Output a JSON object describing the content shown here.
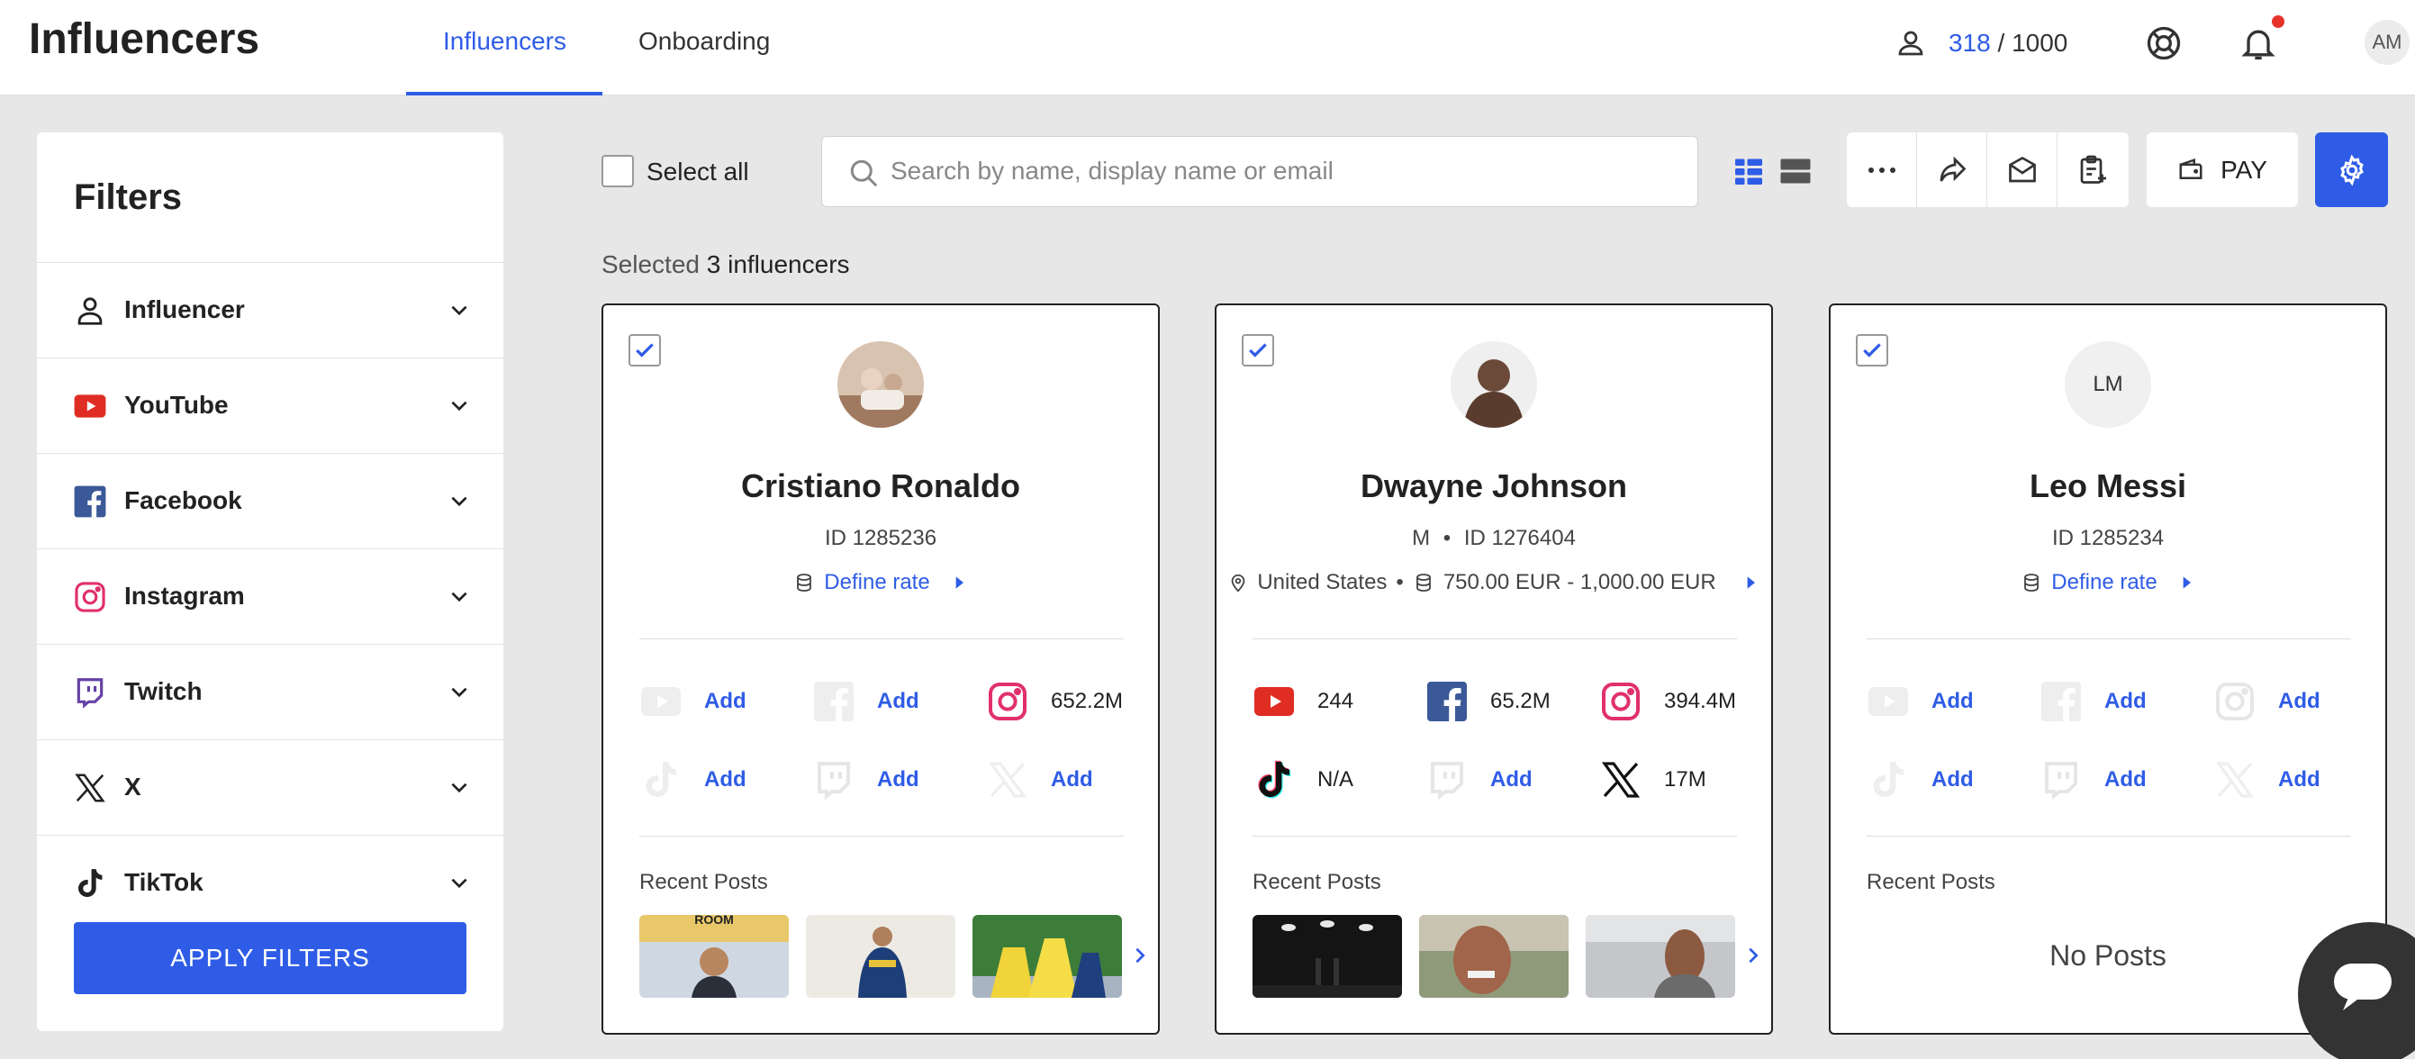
{
  "header": {
    "title": "Influencers",
    "tabs": [
      {
        "label": "Influencers",
        "active": true
      },
      {
        "label": "Onboarding",
        "active": false
      }
    ],
    "counter": {
      "current": "318",
      "separator": " / ",
      "total": "1000"
    },
    "avatar_initials": "AM",
    "accent_color": "#2f5ce6"
  },
  "filters": {
    "title": "Filters",
    "items": [
      {
        "label": "Influencer",
        "icon": "user-icon"
      },
      {
        "label": "YouTube",
        "icon": "youtube-icon"
      },
      {
        "label": "Facebook",
        "icon": "facebook-icon"
      },
      {
        "label": "Instagram",
        "icon": "instagram-icon"
      },
      {
        "label": "Twitch",
        "icon": "twitch-icon"
      },
      {
        "label": "X",
        "icon": "x-icon"
      },
      {
        "label": "TikTok",
        "icon": "tiktok-icon"
      }
    ],
    "apply_label": "APPLY FILTERS"
  },
  "toolbar": {
    "select_all_label": "Select all",
    "search_placeholder": "Search by name, display name or email",
    "pay_label": "PAY"
  },
  "selection": {
    "prefix": "Selected ",
    "count": "3",
    "suffix": " influencers"
  },
  "cards": [
    {
      "name": "Cristiano Ronaldo",
      "id_line": "ID 1285236",
      "rate_label": "Define rate",
      "socials": [
        {
          "network": "youtube",
          "value": "Add",
          "linked": false
        },
        {
          "network": "facebook",
          "value": "Add",
          "linked": false
        },
        {
          "network": "instagram",
          "value": "652.2M",
          "linked": true
        },
        {
          "network": "tiktok",
          "value": "Add",
          "linked": false
        },
        {
          "network": "twitch",
          "value": "Add",
          "linked": false
        },
        {
          "network": "x",
          "value": "Add",
          "linked": false
        }
      ],
      "recent_posts_label": "Recent Posts"
    },
    {
      "name": "Dwayne Johnson",
      "gender": "M",
      "id_line": "ID 1276404",
      "location": "United States",
      "rate_range": "750.00 EUR - 1,000.00 EUR",
      "socials": [
        {
          "network": "youtube",
          "value": "244",
          "linked": true
        },
        {
          "network": "facebook",
          "value": "65.2M",
          "linked": true
        },
        {
          "network": "instagram",
          "value": "394.4M",
          "linked": true
        },
        {
          "network": "tiktok",
          "value": "N/A",
          "linked": true
        },
        {
          "network": "twitch",
          "value": "Add",
          "linked": false
        },
        {
          "network": "x",
          "value": "17M",
          "linked": true
        }
      ],
      "recent_posts_label": "Recent Posts"
    },
    {
      "name": "Leo Messi",
      "initials": "LM",
      "id_line": "ID 1285234",
      "rate_label": "Define rate",
      "socials": [
        {
          "network": "youtube",
          "value": "Add",
          "linked": false
        },
        {
          "network": "facebook",
          "value": "Add",
          "linked": false
        },
        {
          "network": "instagram",
          "value": "Add",
          "linked": false
        },
        {
          "network": "tiktok",
          "value": "Add",
          "linked": false
        },
        {
          "network": "twitch",
          "value": "Add",
          "linked": false
        },
        {
          "network": "x",
          "value": "Add",
          "linked": false
        }
      ],
      "recent_posts_label": "Recent Posts",
      "no_posts_label": "No Posts"
    }
  ]
}
